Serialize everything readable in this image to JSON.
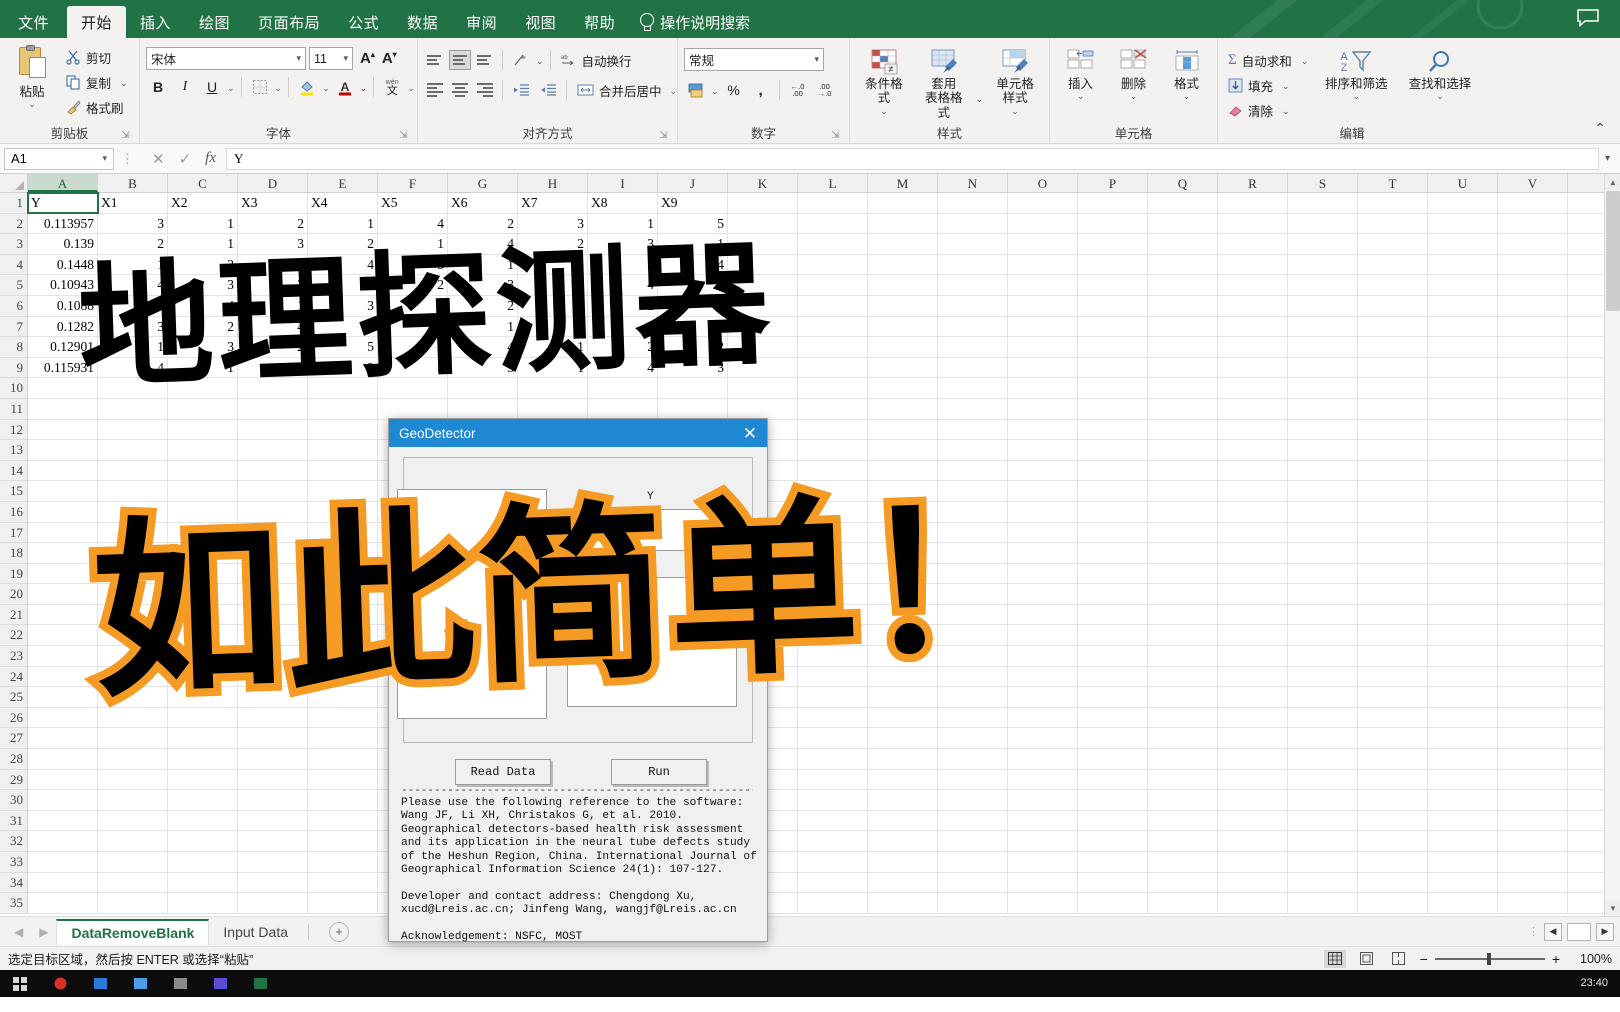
{
  "window": {
    "app": "Excel",
    "comment_icon": "comment-icon"
  },
  "ribbon_tabs": [
    {
      "label": "文件",
      "active": false
    },
    {
      "label": "开始",
      "active": true
    },
    {
      "label": "插入",
      "active": false
    },
    {
      "label": "绘图",
      "active": false
    },
    {
      "label": "页面布局",
      "active": false
    },
    {
      "label": "公式",
      "active": false
    },
    {
      "label": "数据",
      "active": false
    },
    {
      "label": "审阅",
      "active": false
    },
    {
      "label": "视图",
      "active": false
    },
    {
      "label": "帮助",
      "active": false
    }
  ],
  "tell_me": "操作说明搜索",
  "ribbon": {
    "clipboard": {
      "group_label": "剪贴板",
      "paste_label": "粘贴",
      "cut_label": "剪切",
      "copy_label": "复制",
      "format_painter_label": "格式刷"
    },
    "font": {
      "group_label": "字体",
      "font_name": "宋体",
      "font_size": "11",
      "grow_label": "A",
      "shrink_label": "A",
      "bold_label": "B",
      "italic_label": "I",
      "underline_label": "U",
      "phonetic_label": "文"
    },
    "alignment": {
      "group_label": "对齐方式",
      "wrap_text_label": "自动换行",
      "merge_center_label": "合并后居中"
    },
    "number": {
      "group_label": "数字",
      "number_format": "常规",
      "percent_label": "%",
      "comma_label": ",",
      "inc_dec_label": ".00",
      "dec_dec_label": ".00"
    },
    "styles": {
      "group_label": "样式",
      "conditional_label": "条件格式",
      "table_label_line1": "套用",
      "table_label_line2": "表格格式",
      "cellstyle_label": "单元格样式"
    },
    "cells": {
      "group_label": "单元格",
      "insert_label": "插入",
      "delete_label": "删除",
      "format_label": "格式"
    },
    "editing": {
      "group_label": "编辑",
      "autosum_label": "自动求和",
      "fill_label": "填充",
      "clear_label": "清除",
      "sort_filter_label": "排序和筛选",
      "find_select_label": "查找和选择"
    },
    "collapse_icon": "chevron-up-icon"
  },
  "formula_bar": {
    "name_box": "A1",
    "cancel_icon": "close-icon",
    "confirm_icon": "check-icon",
    "function_icon": "fx",
    "value": "Y",
    "expand_icon": "chevron-down-icon"
  },
  "grid": {
    "columns": [
      "A",
      "B",
      "C",
      "D",
      "E",
      "F",
      "G",
      "H",
      "I",
      "J",
      "K",
      "L",
      "M",
      "N",
      "O",
      "P",
      "Q",
      "R",
      "S",
      "T",
      "U",
      "V"
    ],
    "selected_column": "A",
    "rows": [
      "1",
      "2",
      "3",
      "4",
      "5",
      "6",
      "7",
      "8",
      "9",
      "10",
      "11",
      "12",
      "13",
      "14",
      "15",
      "16",
      "17",
      "18",
      "19",
      "20",
      "21",
      "22",
      "23",
      "24",
      "25",
      "26",
      "27",
      "28",
      "29",
      "30",
      "31",
      "32",
      "33",
      "34",
      "35"
    ],
    "data": [
      {
        "A": "Y",
        "B": "X1",
        "C": "X2",
        "D": "X3",
        "E": "X4",
        "F": "X5",
        "G": "X6",
        "H": "X7",
        "I": "X8",
        "J": "X9"
      },
      {
        "A": "0.113957",
        "B": "3",
        "C": "1",
        "D": "2",
        "E": "1",
        "F": "4",
        "G": "2",
        "H": "3",
        "I": "1",
        "J": "5"
      },
      {
        "A": "0.139",
        "B": "2",
        "C": "1",
        "D": "3",
        "E": "2",
        "F": "1",
        "G": "4",
        "H": "2",
        "I": "3",
        "J": "1"
      },
      {
        "A": "0.1448",
        "B": "1",
        "C": "2",
        "D": "1",
        "E": "4",
        "F": "3",
        "G": "1",
        "H": "5",
        "I": "2",
        "J": "4"
      },
      {
        "A": "0.10943",
        "B": "4",
        "C": "3",
        "D": "2",
        "E": "1",
        "F": "2",
        "G": "3",
        "H": "1",
        "I": "4",
        "J": "2"
      },
      {
        "A": "0.1088",
        "B": "2",
        "C": "4",
        "D": "1",
        "E": "3",
        "F": "1",
        "G": "2",
        "H": "4",
        "I": "1",
        "J": "3"
      },
      {
        "A": "0.1282",
        "B": "3",
        "C": "2",
        "D": "4",
        "E": "1",
        "F": "5",
        "G": "1",
        "H": "2",
        "I": "3",
        "J": "2"
      },
      {
        "A": "0.12901",
        "B": "1",
        "C": "3",
        "D": "2",
        "E": "5",
        "F": "2",
        "G": "4",
        "H": "1",
        "I": "2",
        "J": "2"
      },
      {
        "A": "0.115931",
        "B": "4",
        "C": "1",
        "D": "3",
        "E": "2",
        "F": "5",
        "G": "3",
        "H": "1",
        "I": "4",
        "J": "3"
      }
    ]
  },
  "sheet_tabs": {
    "prev_icon": "chevron-left-icon",
    "next_icon": "chevron-right-icon",
    "tabs": [
      {
        "label": "DataRemoveBlank",
        "active": true
      },
      {
        "label": "Input Data",
        "active": false
      }
    ],
    "add_label": "+"
  },
  "status_bar": {
    "message": "选定目标区域，然后按 ENTER 或选择“粘贴”",
    "normal_view_icon": "grid-view-icon",
    "layout_view_icon": "page-layout-icon",
    "pagebreak_view_icon": "page-break-icon",
    "zoom_out_label": "−",
    "zoom_in_label": "+",
    "zoom_level": "100%"
  },
  "dialog": {
    "title": "GeoDetector",
    "close_icon": "close-icon",
    "y_label": "Y",
    "read_data_label": "Read Data",
    "run_label": "Run",
    "divider": "--------------------------------------------------------------",
    "reference": "Please use the following reference to the software:\nWang JF, Li XH, Christakos G, et al. 2010.\nGeographical detectors-based health risk assessment\nand its application in the neural tube defects study\nof the Heshun Region, China. International Journal of\nGeographical Information Science 24(1): 107-127.\n\nDeveloper and contact address: Chengdong Xu,\nxucd@Lreis.ac.cn; Jinfeng Wang, wangjf@Lreis.ac.cn\n\nAcknowledgement: NSFC, MOST"
  },
  "overlay_captions": {
    "line1": "地理探测器",
    "line2": "如此简单！"
  },
  "taskbar": {
    "clock_time": "23:40"
  },
  "colors": {
    "excel_green": "#217346",
    "dialog_blue": "#1e88d2",
    "caption_orange": "#f59a23"
  }
}
